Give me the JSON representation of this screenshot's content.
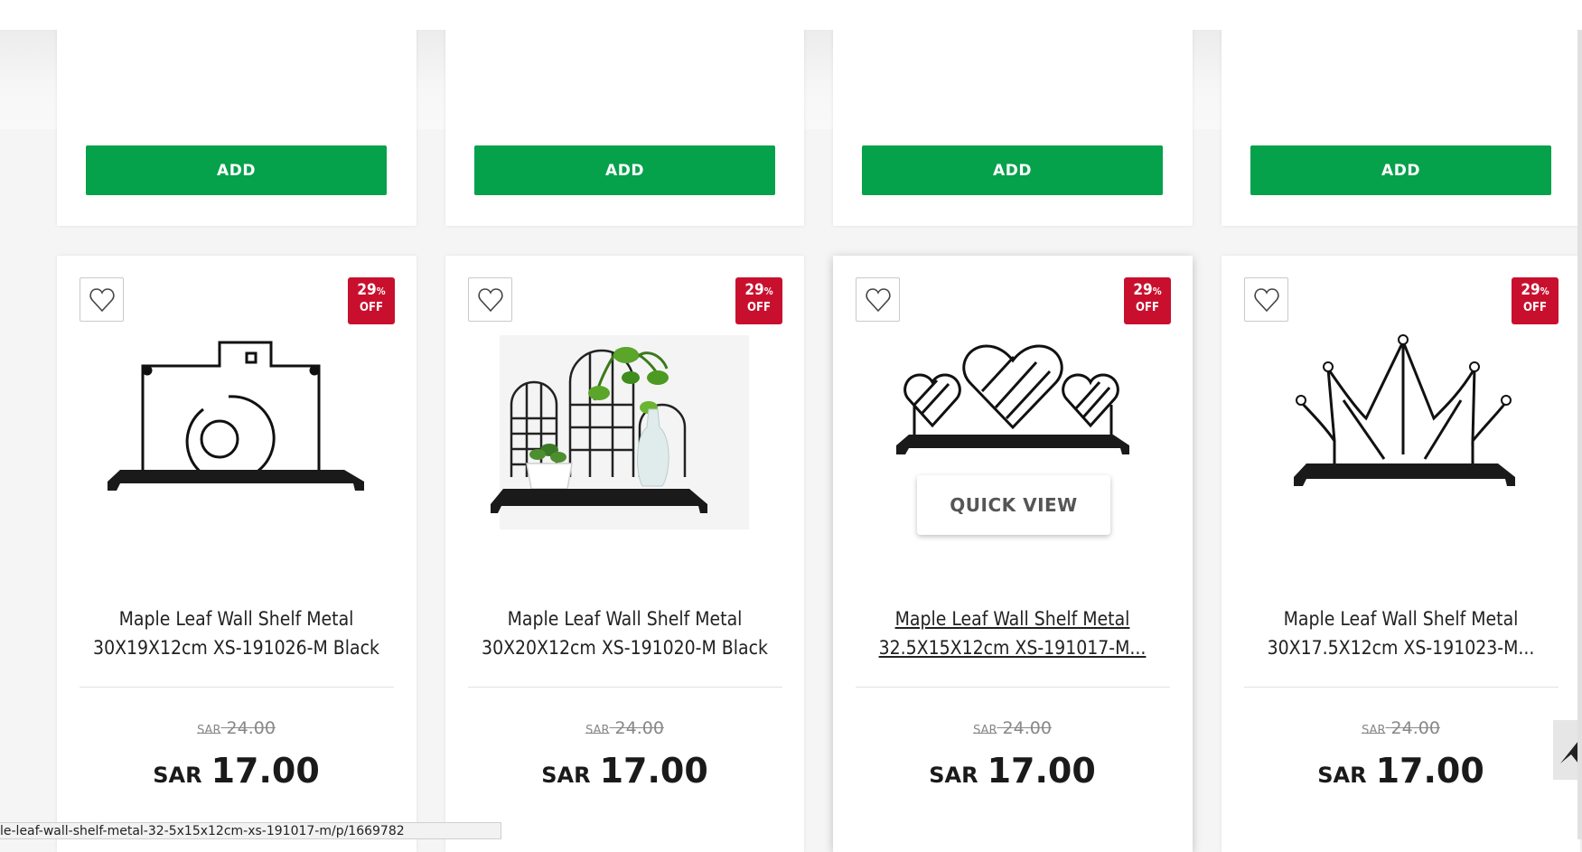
{
  "top_row": {
    "cards": [
      {
        "button": "ADD"
      },
      {
        "button": "ADD"
      },
      {
        "button": "ADD"
      },
      {
        "button": "ADD"
      }
    ]
  },
  "products": [
    {
      "title_line1": "Maple Leaf Wall Shelf Metal",
      "title_line2": "30X19X12cm XS-191026-M Black",
      "discount": "29",
      "discount_unit": "%",
      "discount_label": "OFF",
      "old_currency": "SAR",
      "old_price": "24.00",
      "currency": "SAR",
      "price": "17.00",
      "image_icon": "camera-shelf-image"
    },
    {
      "title_line1": "Maple Leaf Wall Shelf Metal",
      "title_line2": "30X20X12cm XS-191020-M Black",
      "discount": "29",
      "discount_unit": "%",
      "discount_label": "OFF",
      "old_currency": "SAR",
      "old_price": "24.00",
      "currency": "SAR",
      "price": "17.00",
      "image_icon": "grid-arch-shelf-image"
    },
    {
      "title_line1": "Maple Leaf Wall Shelf Metal",
      "title_line2": "32.5X15X12cm XS-191017-M...",
      "discount": "29",
      "discount_unit": "%",
      "discount_label": "OFF",
      "old_currency": "SAR",
      "old_price": "24.00",
      "currency": "SAR",
      "price": "17.00",
      "quick_view": "QUICK VIEW",
      "image_icon": "hearts-shelf-image"
    },
    {
      "title_line1": "Maple Leaf Wall Shelf Metal",
      "title_line2": "30X17.5X12cm XS-191023-M...",
      "discount": "29",
      "discount_unit": "%",
      "discount_label": "OFF",
      "old_currency": "SAR",
      "old_price": "24.00",
      "currency": "SAR",
      "price": "17.00",
      "image_icon": "crown-shelf-image"
    }
  ],
  "status_bar": {
    "url": "le-leaf-wall-shelf-metal-32-5x15x12cm-xs-191017-m/p/1669782"
  },
  "colors": {
    "add_button": "#05a14b",
    "discount_badge": "#c8102e"
  }
}
